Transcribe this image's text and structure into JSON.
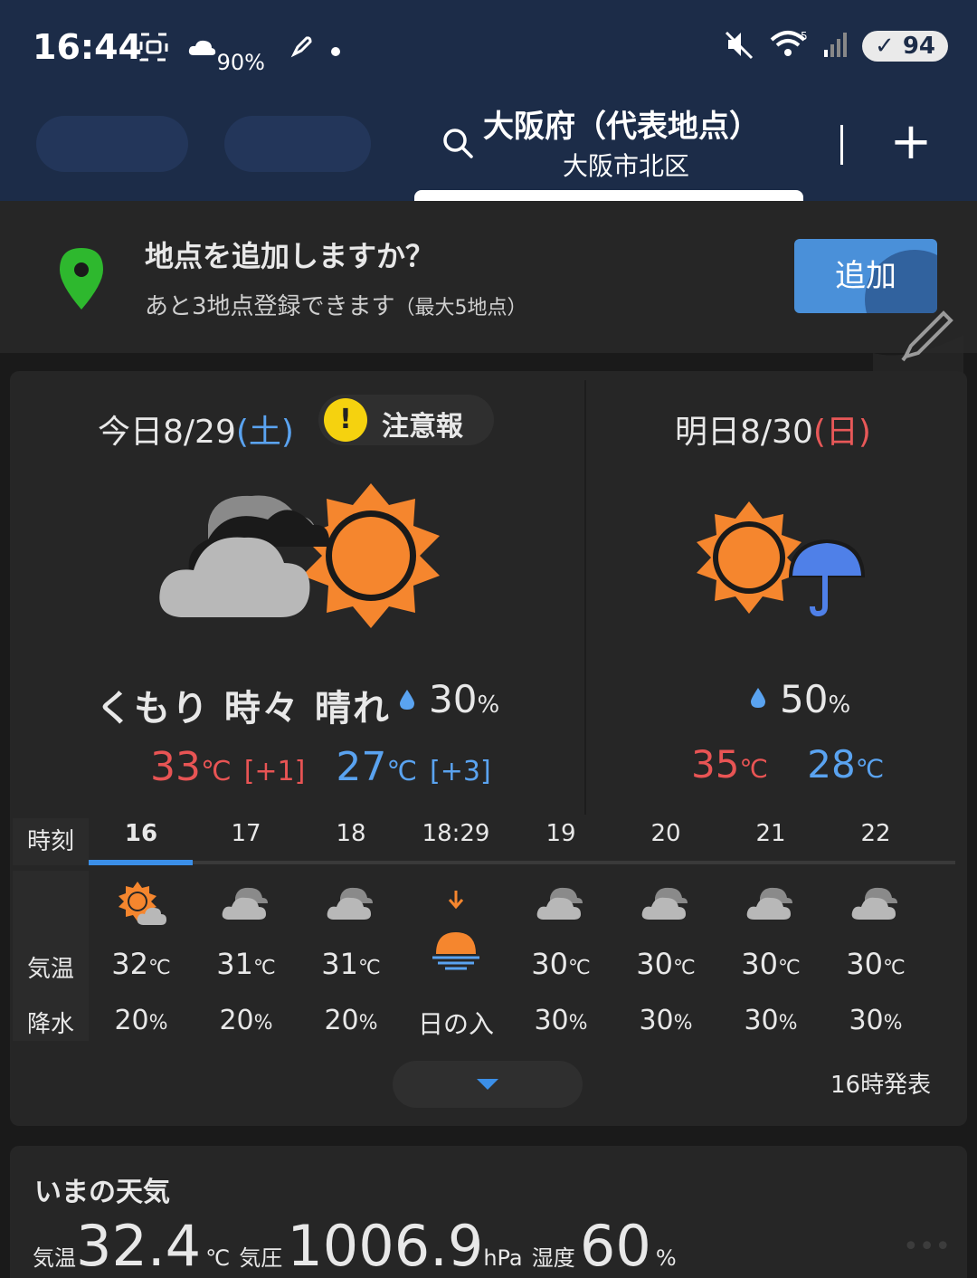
{
  "status_bar": {
    "time": "16:44",
    "weather_small": "90%",
    "wifi_badge": "5",
    "battery": "94"
  },
  "header": {
    "location_title": "大阪府（代表地点）",
    "location_sub": "大阪市北区",
    "add_tab_symbol": "+"
  },
  "banner": {
    "title": "地点を追加しますか？",
    "sub_main": "あと3地点登録できます",
    "sub_note": "（最大5地点）",
    "add_button": "追加"
  },
  "today": {
    "date_prefix": "今日8/29",
    "weekday": "(土)",
    "warning_label": "注意報",
    "condition": "くもり 時々 晴れ",
    "precip": "30",
    "precip_unit": "%",
    "high": "33",
    "high_diff": "[+1]",
    "low": "27",
    "low_diff": "[+3]",
    "temp_unit": "℃"
  },
  "tomorrow": {
    "date_prefix": "明日8/30",
    "weekday": "(日)",
    "precip": "50",
    "precip_unit": "%",
    "high": "35",
    "low": "28",
    "temp_unit": "℃"
  },
  "hourly": {
    "label_time": "時刻",
    "label_temp": "気温",
    "label_precip": "降水",
    "hours": [
      "16",
      "17",
      "18",
      "18:29",
      "19",
      "20",
      "21",
      "22"
    ],
    "temps": [
      "32",
      "31",
      "31",
      "",
      "30",
      "30",
      "30",
      "30"
    ],
    "precip": [
      "20",
      "20",
      "20",
      "日の入",
      "30",
      "30",
      "30",
      "30"
    ],
    "temp_unit": "℃",
    "precip_unit": "%",
    "issued": "16時発表"
  },
  "now": {
    "title": "いまの天気",
    "temp_label": "気温",
    "temp_value": "32.4",
    "temp_unit": "℃",
    "pressure_label": "気圧",
    "pressure_value": "1006.9",
    "pressure_unit": "hPa",
    "humidity_label": "湿度",
    "humidity_value": "60",
    "humidity_unit": "%"
  },
  "colors": {
    "header_bg": "#1c2c48",
    "accent_blue": "#4a90d9",
    "high_temp": "#e85454",
    "low_temp": "#5aa3f0",
    "sun": "#f5862e",
    "warning": "#f5d20f"
  },
  "icons": [
    "search-icon",
    "plus-icon",
    "map-pin-icon",
    "pencil-icon",
    "warning-icon",
    "cloudy-sunny-icon",
    "sunny-rain-icon",
    "drop-icon",
    "sunset-icon",
    "chevron-down-icon"
  ]
}
